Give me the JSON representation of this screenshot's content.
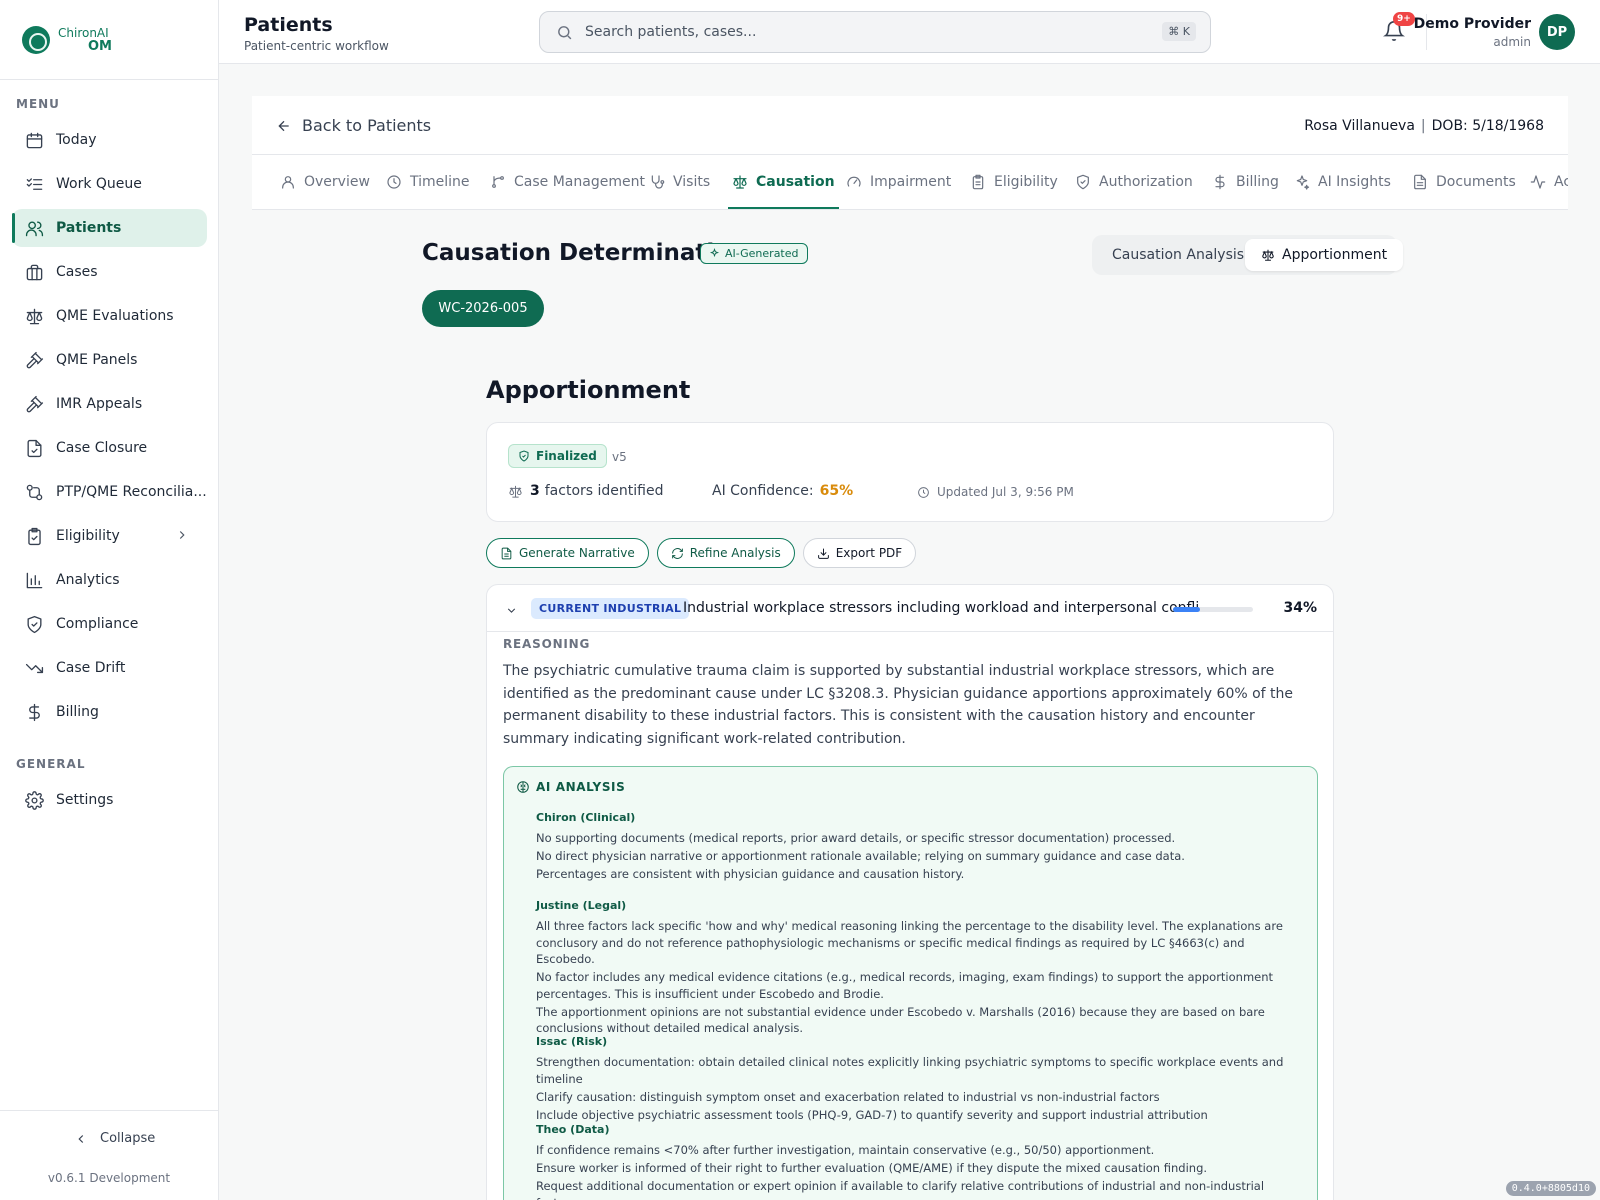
{
  "app": {
    "logo_line1": "ChironAI",
    "logo_line2": "OM",
    "version": "v0.6.1 Development",
    "build": "0.4.0+8805d10"
  },
  "sidebar": {
    "menu_label": "MENU",
    "general_label": "GENERAL",
    "collapse_label": "Collapse",
    "items": [
      {
        "label": "Today",
        "icon": "calendar-icon"
      },
      {
        "label": "Work Queue",
        "icon": "list-check-icon"
      },
      {
        "label": "Patients",
        "icon": "users-icon",
        "active": true
      },
      {
        "label": "Cases",
        "icon": "briefcase-icon"
      },
      {
        "label": "QME Evaluations",
        "icon": "scale-icon"
      },
      {
        "label": "QME Panels",
        "icon": "gavel-icon"
      },
      {
        "label": "IMR Appeals",
        "icon": "gavel-icon"
      },
      {
        "label": "Case Closure",
        "icon": "file-check-icon"
      },
      {
        "label": "PTP/QME Reconcilia...",
        "icon": "git-compare-icon"
      },
      {
        "label": "Eligibility",
        "icon": "clipboard-check-icon"
      },
      {
        "label": "Analytics",
        "icon": "bar-chart-icon"
      },
      {
        "label": "Compliance",
        "icon": "shield-check-icon"
      },
      {
        "label": "Case Drift",
        "icon": "trending-down-icon"
      },
      {
        "label": "Billing",
        "icon": "dollar-icon"
      }
    ],
    "general_items": [
      {
        "label": "Settings",
        "icon": "gear-icon"
      }
    ]
  },
  "header": {
    "title": "Patients",
    "subtitle": "Patient-centric workflow",
    "search_placeholder": "Search patients, cases...",
    "search_shortcut": "⌘ K",
    "notification_count": "9+",
    "user_name": "Demo Provider",
    "user_role": "admin",
    "user_initials": "DP"
  },
  "patient": {
    "back_label": "Back to Patients",
    "name": "Rosa Villanueva",
    "separator": "|",
    "dob": "DOB: 5/18/1968",
    "tabs": [
      {
        "label": "Overview",
        "icon": "user-icon"
      },
      {
        "label": "Timeline",
        "icon": "clock-icon"
      },
      {
        "label": "Case Management",
        "icon": "branch-icon"
      },
      {
        "label": "Visits",
        "icon": "stethoscope-icon"
      },
      {
        "label": "Causation",
        "icon": "scale-icon",
        "active": true
      },
      {
        "label": "Impairment",
        "icon": "gauge-icon"
      },
      {
        "label": "Eligibility",
        "icon": "clipboard-icon"
      },
      {
        "label": "Authorization",
        "icon": "shield-icon"
      },
      {
        "label": "Billing",
        "icon": "dollar-icon"
      },
      {
        "label": "AI Insights",
        "icon": "sparkles-icon"
      },
      {
        "label": "Documents",
        "icon": "file-icon"
      },
      {
        "label": "Ac",
        "icon": "activity-icon"
      }
    ]
  },
  "causation": {
    "title": "Causation Determination",
    "ai_badge": "AI-Generated",
    "toggle": [
      {
        "label": "Causation Analysis"
      },
      {
        "label": "Apportionment",
        "active": true
      }
    ],
    "case_id": "WC-2026-005"
  },
  "apportionment": {
    "title": "Apportionment",
    "status": "Finalized",
    "version": "v5",
    "factors_count": "3",
    "factors_label": "factors identified",
    "confidence_label": "AI Confidence:",
    "confidence_value": "65%",
    "updated": "Updated Jul 3, 9:56 PM",
    "actions": [
      "Generate Narrative",
      "Refine Analysis",
      "Export PDF"
    ],
    "factor": {
      "category": "CURRENT INDUSTRIAL",
      "description": "Industrial workplace stressors including workload and interpersonal confli...",
      "percent_label": "34%",
      "percent_value": 0.34,
      "reasoning_label": "REASONING",
      "reasoning": "The psychiatric cumulative trauma claim is supported by substantial industrial workplace stressors, which are identified as the predominant cause under LC §3208.3. Physician guidance apportions approximately 60% of the permanent disability to these industrial factors. This is consistent with the causation history and encounter summary indicating significant work-related contribution.",
      "ai_analysis": {
        "title": "AI ANALYSIS",
        "agents": [
          {
            "name": "Chiron (Clinical)",
            "lines": [
              "No supporting documents (medical reports, prior award details, or specific stressor documentation) processed.",
              "No direct physician narrative or apportionment rationale available; relying on summary guidance and case data.",
              "Percentages are consistent with physician guidance and causation history."
            ]
          },
          {
            "name": "Justine (Legal)",
            "lines": [
              "All three factors lack specific 'how and why' medical reasoning linking the percentage to the disability level. The explanations are conclusory and do not reference pathophysiologic mechanisms or specific medical findings as required by LC §4663(c) and Escobedo.",
              "No factor includes any medical evidence citations (e.g., medical records, imaging, exam findings) to support the apportionment percentages. This is insufficient under Escobedo and Brodie.",
              "The apportionment opinions are not substantial evidence under Escobedo v. Marshalls (2016) because they are based on bare conclusions without detailed medical analysis."
            ]
          },
          {
            "name": "Issac (Risk)",
            "lines": [
              "Strengthen documentation: obtain detailed clinical notes explicitly linking psychiatric symptoms to specific workplace events and timeline",
              "Clarify causation: distinguish symptom onset and exacerbation related to industrial vs non-industrial factors",
              "Include objective psychiatric assessment tools (PHQ-9, GAD-7) to quantify severity and support industrial attribution"
            ]
          },
          {
            "name": "Theo (Data)",
            "lines": [
              "If confidence remains <70% after further investigation, maintain conservative (e.g., 50/50) apportionment.",
              "Ensure worker is informed of their right to further evaluation (QME/AME) if they dispute the mixed causation finding.",
              "Request additional documentation or expert opinion if available to clarify relative contributions of industrial and non-industrial factors."
            ]
          }
        ]
      }
    }
  }
}
